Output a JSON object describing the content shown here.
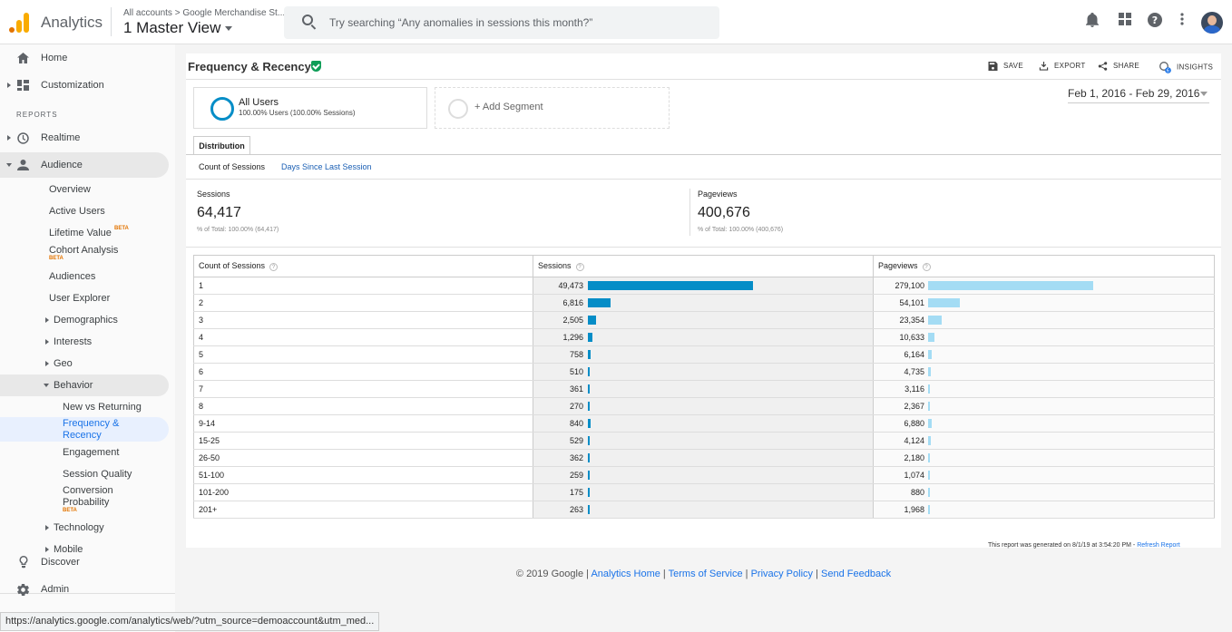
{
  "header": {
    "app_name": "Analytics",
    "account_crumb": "All accounts > Google Merchandise St...",
    "view_name": "1 Master View",
    "search_placeholder": "Try searching “Any anomalies in sessions this month?”"
  },
  "sidebar": {
    "home": "Home",
    "customization": "Customization",
    "reports_label": "REPORTS",
    "realtime": "Realtime",
    "audience": "Audience",
    "audience_items": [
      "Overview",
      "Active Users",
      "Lifetime Value",
      "Cohort Analysis",
      "Audiences",
      "User Explorer",
      "Demographics",
      "Interests",
      "Geo",
      "Behavior"
    ],
    "beta": "BETA",
    "behavior_items": [
      "New vs Returning",
      "Frequency & Recency",
      "Engagement",
      "Session Quality",
      "Conversion Probability"
    ],
    "behavior_active_lines": [
      "Frequency &",
      "Recency"
    ],
    "conversion_lines": [
      "Conversion",
      "Probability"
    ],
    "technology": "Technology",
    "mobile": "Mobile",
    "discover": "Discover",
    "admin": "Admin"
  },
  "page": {
    "title": "Frequency & Recency",
    "actions": [
      "SAVE",
      "EXPORT",
      "SHARE",
      "INSIGHTS"
    ],
    "segment_name": "All Users",
    "segment_sub": "100.00% Users (100.00% Sessions)",
    "add_segment": "+ Add Segment",
    "date_range": "Feb 1, 2016 - Feb 29, 2016",
    "tab": "Distribution",
    "subtabs": [
      "Count of Sessions",
      "Days Since Last Session"
    ],
    "metrics": [
      {
        "label": "Sessions",
        "value": "64,417",
        "total_prefix": "% of Total:",
        "total_pct": "100.00%",
        "total_abs": "(64,417)"
      },
      {
        "label": "Pageviews",
        "value": "400,676",
        "total_prefix": "% of Total:",
        "total_pct": "100.00%",
        "total_abs": "(400,676)"
      }
    ],
    "report_note": "This report was generated on 8/1/19 at 3:54:20 PM - ",
    "refresh": "Refresh Report"
  },
  "table": {
    "headers": [
      "Count of Sessions",
      "Sessions",
      "Pageviews"
    ],
    "rows": [
      {
        "count": "1",
        "sessions": "49,473",
        "sessions_val": 49473,
        "pageviews": "279,100",
        "pageviews_val": 279100
      },
      {
        "count": "2",
        "sessions": "6,816",
        "sessions_val": 6816,
        "pageviews": "54,101",
        "pageviews_val": 54101
      },
      {
        "count": "3",
        "sessions": "2,505",
        "sessions_val": 2505,
        "pageviews": "23,354",
        "pageviews_val": 23354
      },
      {
        "count": "4",
        "sessions": "1,296",
        "sessions_val": 1296,
        "pageviews": "10,633",
        "pageviews_val": 10633
      },
      {
        "count": "5",
        "sessions": "758",
        "sessions_val": 758,
        "pageviews": "6,164",
        "pageviews_val": 6164
      },
      {
        "count": "6",
        "sessions": "510",
        "sessions_val": 510,
        "pageviews": "4,735",
        "pageviews_val": 4735
      },
      {
        "count": "7",
        "sessions": "361",
        "sessions_val": 361,
        "pageviews": "3,116",
        "pageviews_val": 3116
      },
      {
        "count": "8",
        "sessions": "270",
        "sessions_val": 270,
        "pageviews": "2,367",
        "pageviews_val": 2367
      },
      {
        "count": "9-14",
        "sessions": "840",
        "sessions_val": 840,
        "pageviews": "6,880",
        "pageviews_val": 6880
      },
      {
        "count": "15-25",
        "sessions": "529",
        "sessions_val": 529,
        "pageviews": "4,124",
        "pageviews_val": 4124
      },
      {
        "count": "26-50",
        "sessions": "362",
        "sessions_val": 362,
        "pageviews": "2,180",
        "pageviews_val": 2180
      },
      {
        "count": "51-100",
        "sessions": "259",
        "sessions_val": 259,
        "pageviews": "1,074",
        "pageviews_val": 1074
      },
      {
        "count": "101-200",
        "sessions": "175",
        "sessions_val": 175,
        "pageviews": "880",
        "pageviews_val": 880
      },
      {
        "count": "201+",
        "sessions": "263",
        "sessions_val": 263,
        "pageviews": "1,968",
        "pageviews_val": 1968
      }
    ]
  },
  "footer": {
    "copyright": "© 2019 Google",
    "links": [
      "Analytics Home",
      "Terms of Service",
      "Privacy Policy",
      "Send Feedback"
    ]
  },
  "status_url": "https://analytics.google.com/analytics/web/?utm_source=demoaccount&utm_med...",
  "colors": {
    "sessions_bar": "#058dc7",
    "pageviews_bar": "#a4dcf4",
    "link": "#1a73e8",
    "segment_ring": "#058dc7"
  }
}
